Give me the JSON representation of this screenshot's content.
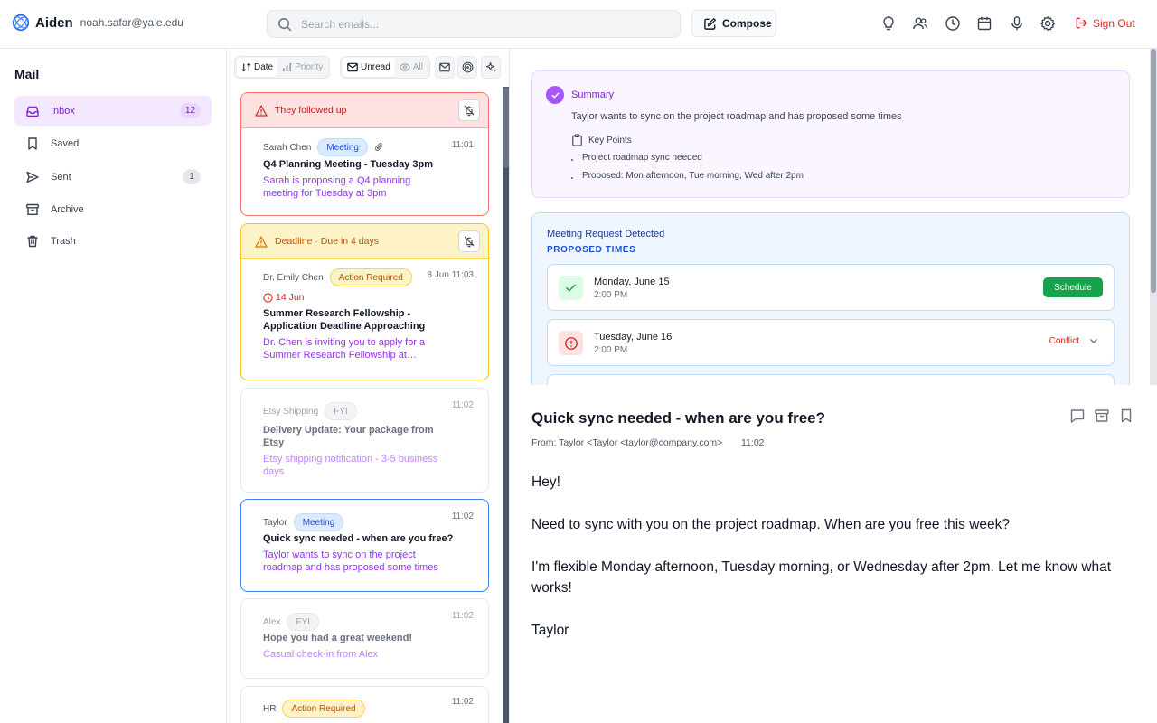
{
  "app": {
    "name": "Aiden",
    "user_email": "noah.safar@yale.edu",
    "search_placeholder": "Search emails...",
    "compose_label": "Compose",
    "signout_label": "Sign Out",
    "toolbar_icons": [
      "lightbulb-icon",
      "contacts-icon",
      "clock-icon",
      "calendar-icon",
      "microphone-icon",
      "gear-icon"
    ]
  },
  "sidebar": {
    "title": "Mail",
    "items": [
      {
        "label": "Inbox",
        "icon": "inbox-icon",
        "badge": "12",
        "active": true
      },
      {
        "label": "Saved",
        "icon": "bookmark-icon"
      },
      {
        "label": "Sent",
        "icon": "send-icon",
        "badge": "1"
      },
      {
        "label": "Archive",
        "icon": "archive-icon"
      },
      {
        "label": "Trash",
        "icon": "trash-icon"
      }
    ]
  },
  "list_toolbar": {
    "sort": [
      {
        "label": "Date",
        "active": true
      },
      {
        "label": "Priority",
        "active": false
      }
    ],
    "filter": [
      {
        "label": "Unread",
        "active": true
      },
      {
        "label": "All",
        "active": false
      }
    ],
    "extra_icons": [
      "mail-icon",
      "target-icon",
      "sparkle-icon"
    ]
  },
  "emails": [
    {
      "alert": "They followed up",
      "alert_color": "#b91c1c",
      "sender": "Sarah Chen",
      "tag": "Meeting",
      "attachment": true,
      "time": "11:01",
      "subject": "Q4 Planning Meeting - Tuesday 3pm",
      "preview": "Sarah is proposing a Q4 planning meeting for Tuesday at 3pm"
    },
    {
      "alert": "Deadline · Due in 4 days",
      "alert_color": "#b45309",
      "sender": "Dr. Emily Chen",
      "tag": "Action Required",
      "time": "8 Jun 11:03",
      "due": "14 Jun",
      "subject": "Summer Research Fellowship - Application Deadline Approaching",
      "preview": "Dr. Chen is inviting you to apply for a Summer Research Fellowship at…"
    },
    {
      "sender": "Etsy Shipping",
      "tag": "FYI",
      "time": "11:02",
      "subject": "Delivery Update: Your package from Etsy",
      "preview": "Etsy shipping notification - 3-5 business days"
    },
    {
      "sender": "Taylor",
      "tag": "Meeting",
      "time": "11:02",
      "selected": true,
      "subject": "Quick sync needed - when are you free?",
      "preview": "Taylor wants to sync on the project roadmap and has proposed some times"
    },
    {
      "sender": "Alex",
      "tag": "FYI",
      "time": "11:02",
      "subject": "Hope you had a great weekend!",
      "preview": "Casual check-in from Alex"
    },
    {
      "sender": "HR",
      "tag": "Action Required",
      "time": "11:02"
    }
  ],
  "summary": {
    "title": "Summary",
    "text": "Taylor wants to sync on the project roadmap and has proposed some times",
    "key_points_label": "Key Points",
    "points": [
      "Project roadmap sync needed",
      "Proposed: Mon afternoon, Tue morning, Wed after 2pm"
    ]
  },
  "meeting": {
    "title": "Meeting Request Detected",
    "subtitle": "PROPOSED TIMES",
    "slots": [
      {
        "day": "Monday, June 15",
        "time": "2:00 PM",
        "status": "available",
        "action": "Schedule"
      },
      {
        "day": "Tuesday, June 16",
        "time": "2:00 PM",
        "status": "conflict",
        "action": "Conflict"
      }
    ],
    "colors": {
      "schedule": "#16a34a",
      "conflict": "#dc2626"
    }
  },
  "email_view": {
    "subject": "Quick sync needed - when are you free?",
    "from": "From: Taylor <Taylor <taylor@company.com>",
    "time": "11:02",
    "actions": [
      "comment-icon",
      "archive-icon",
      "bookmark-icon"
    ],
    "body": [
      "Hey!",
      "Need to sync with you on the project roadmap. When are you free this week?",
      "I'm flexible Monday afternoon, Tuesday morning, or Wednesday after 2pm. Let me know what works!",
      "Taylor"
    ]
  },
  "colors": {
    "accent_purple": "#7e22ce",
    "danger": "#dc2626",
    "selected_border": "#3b82f6"
  }
}
